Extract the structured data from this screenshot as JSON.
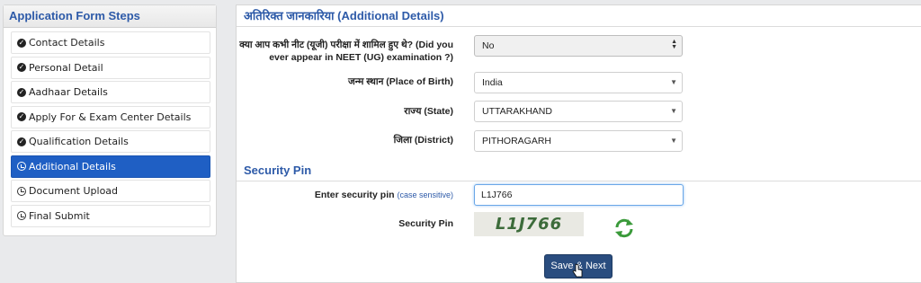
{
  "sidebar": {
    "title": "Application Form Steps",
    "steps": [
      {
        "label": "Contact Details",
        "icon": "check-circle-icon",
        "active": false
      },
      {
        "label": "Personal Detail",
        "icon": "check-circle-icon",
        "active": false
      },
      {
        "label": "Aadhaar Details",
        "icon": "check-circle-icon",
        "active": false
      },
      {
        "label": "Apply For & Exam Center Details",
        "icon": "check-circle-icon",
        "active": false
      },
      {
        "label": "Qualification Details",
        "icon": "check-circle-icon",
        "active": false
      },
      {
        "label": "Additional Details",
        "icon": "clock-icon",
        "active": true
      },
      {
        "label": "Document Upload",
        "icon": "clock-icon",
        "active": false
      },
      {
        "label": "Final Submit",
        "icon": "clock-icon",
        "active": false
      }
    ]
  },
  "additional": {
    "heading": "अतिरिक्त जानकारिया (Additional Details)",
    "neet_label_line1": "क्या आप कभी नीट (यूजी) परीक्षा में शामिल हुए थे? (Did you",
    "neet_label_line2": "ever appear in NEET (UG) examination ?)",
    "neet_value": "No",
    "birth_label": "जन्म स्थान (Place of Birth)",
    "birth_value": "India",
    "state_label": "राज्य (State)",
    "state_value": "UTTARAKHAND",
    "district_label": "जिला (District)",
    "district_value": "PITHORAGARH"
  },
  "security": {
    "heading": "Security Pin",
    "enter_label": "Enter security pin",
    "enter_hint": "(case sensitive)",
    "input_value": "L1J766",
    "pin_label": "Security Pin",
    "captcha_text": "L1J766"
  },
  "actions": {
    "save_next": "Save & Next"
  },
  "colors": {
    "accent": "#2d5aa8",
    "active_step": "#1f5fc4",
    "button": "#2a4d7f"
  }
}
